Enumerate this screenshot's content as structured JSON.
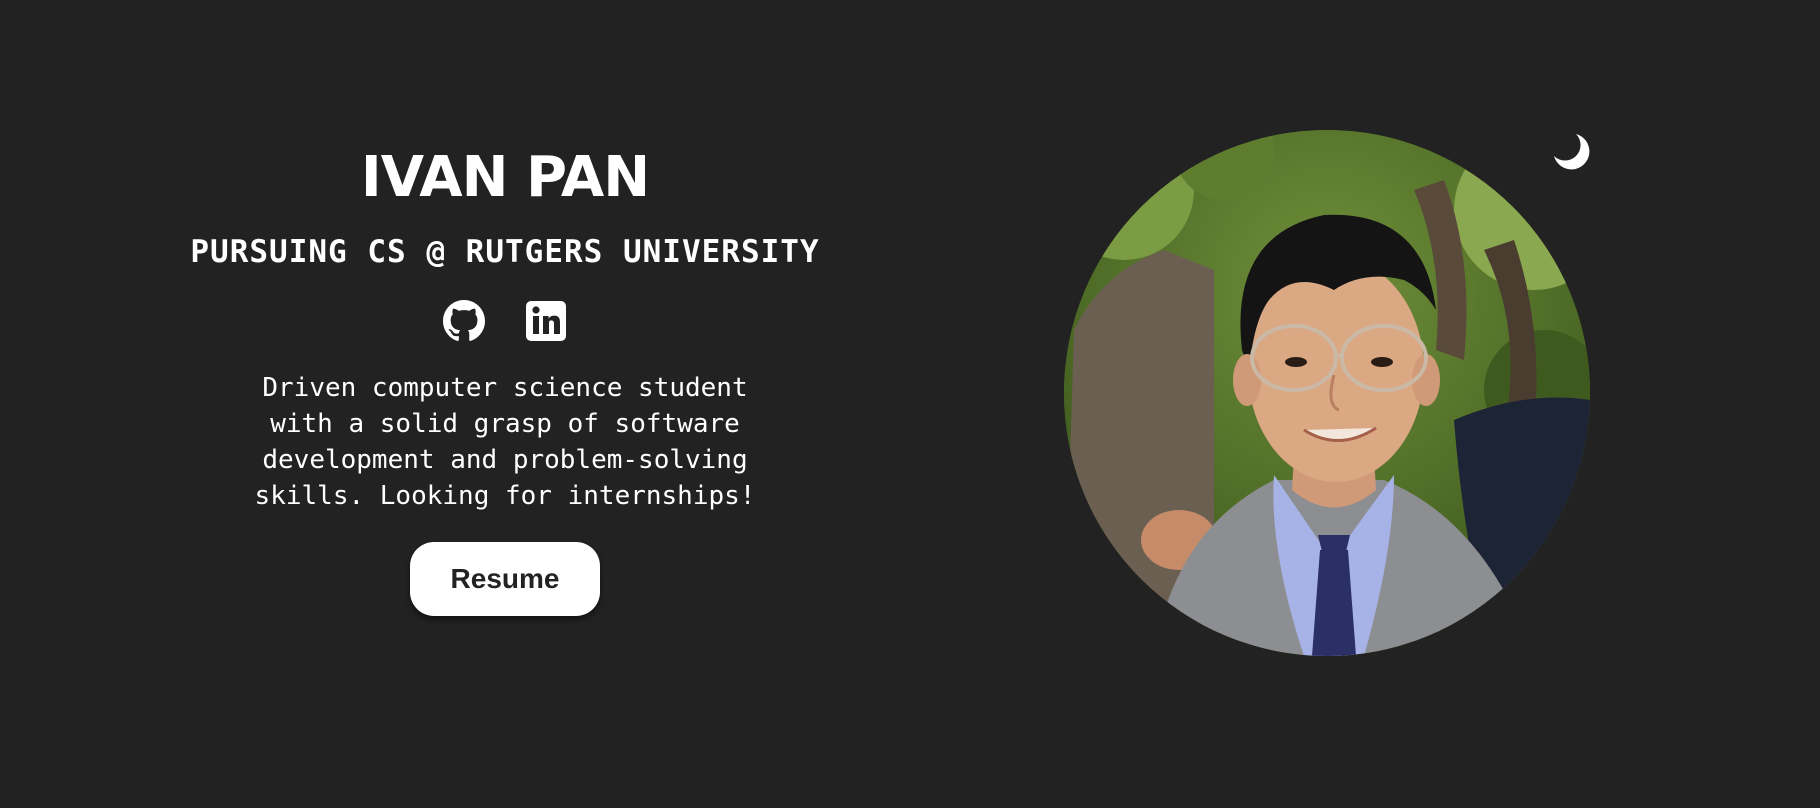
{
  "hero": {
    "name": "IVAN PAN",
    "tagline": "PURSUING CS @ RUTGERS UNIVERSITY",
    "bio": "Driven computer science student with a solid grasp of software development and problem-solving skills. Looking for internships!",
    "resume_label": "Resume"
  },
  "socials": [
    {
      "icon": "github-icon"
    },
    {
      "icon": "linkedin-icon"
    }
  ],
  "theme_toggle": {
    "icon": "moon-icon"
  },
  "profile_photo": {
    "alt": "Profile photo"
  },
  "colors": {
    "background": "#222222",
    "text": "#ffffff",
    "button_bg": "#ffffff",
    "button_text": "#222222"
  }
}
